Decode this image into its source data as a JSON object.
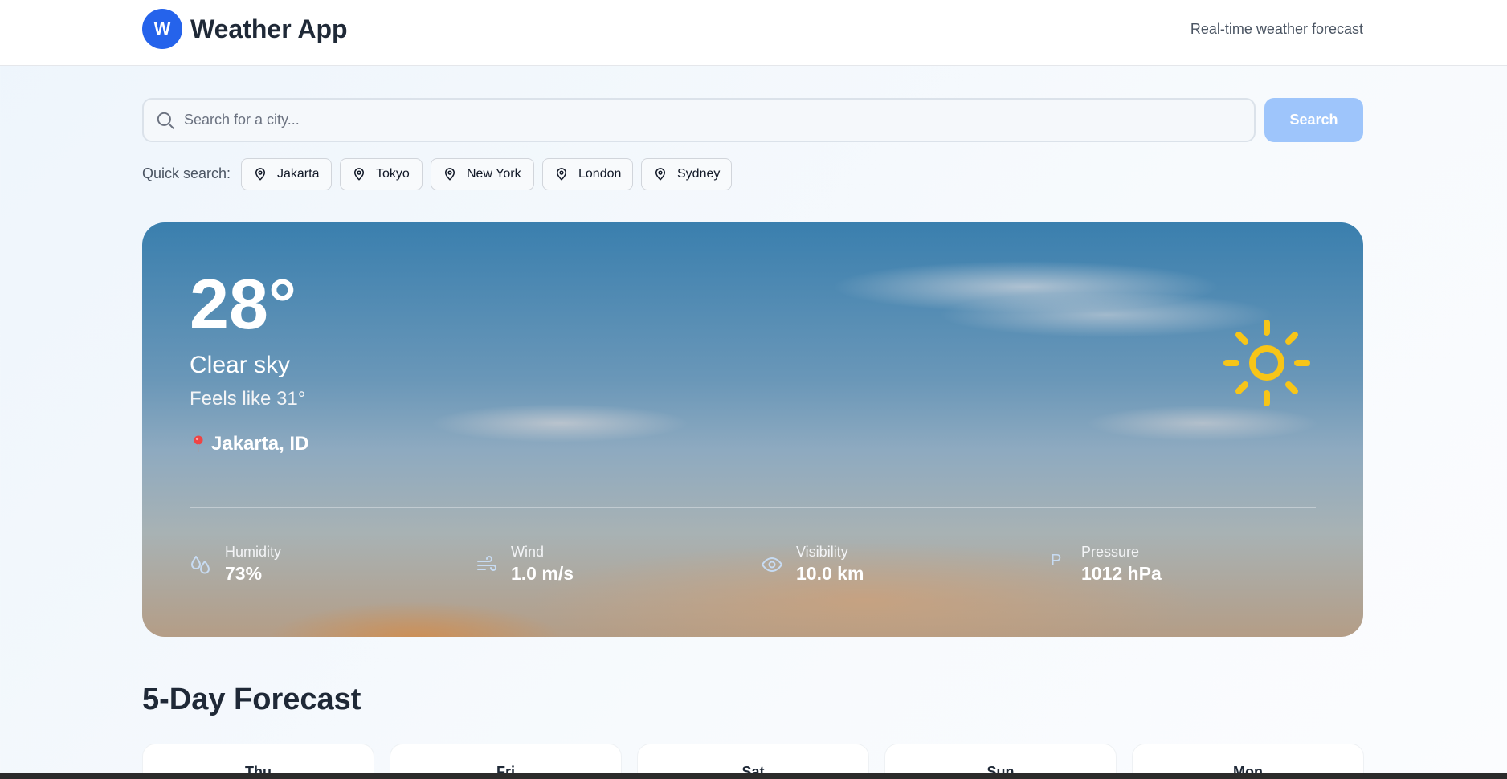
{
  "header": {
    "logo_letter": "W",
    "title": "Weather App",
    "tagline": "Real-time weather forecast"
  },
  "search": {
    "placeholder": "Search for a city...",
    "value": "",
    "button_label": "Search"
  },
  "quick_search": {
    "label": "Quick search:",
    "cities": [
      "Jakarta",
      "Tokyo",
      "New York",
      "London",
      "Sydney"
    ]
  },
  "current": {
    "temperature": "28°",
    "condition": "Clear sky",
    "feels_like": "Feels like 31°",
    "location": "Jakarta, ID",
    "weather_icon": "sun-icon",
    "stats": [
      {
        "label": "Humidity",
        "value": "73%",
        "icon": "humidity-icon"
      },
      {
        "label": "Wind",
        "value": "1.0 m/s",
        "icon": "wind-icon"
      },
      {
        "label": "Visibility",
        "value": "10.0 km",
        "icon": "eye-icon"
      },
      {
        "label": "Pressure",
        "value": "1012 hPa",
        "icon": "pressure-icon",
        "icon_text": "P"
      }
    ]
  },
  "forecast": {
    "title": "5-Day Forecast",
    "days": [
      "Thu",
      "Fri",
      "Sat",
      "Sun",
      "Mon"
    ]
  },
  "colors": {
    "accent": "#2563eb",
    "search_button": "#9ec5fb",
    "sun": "#f7c518"
  }
}
